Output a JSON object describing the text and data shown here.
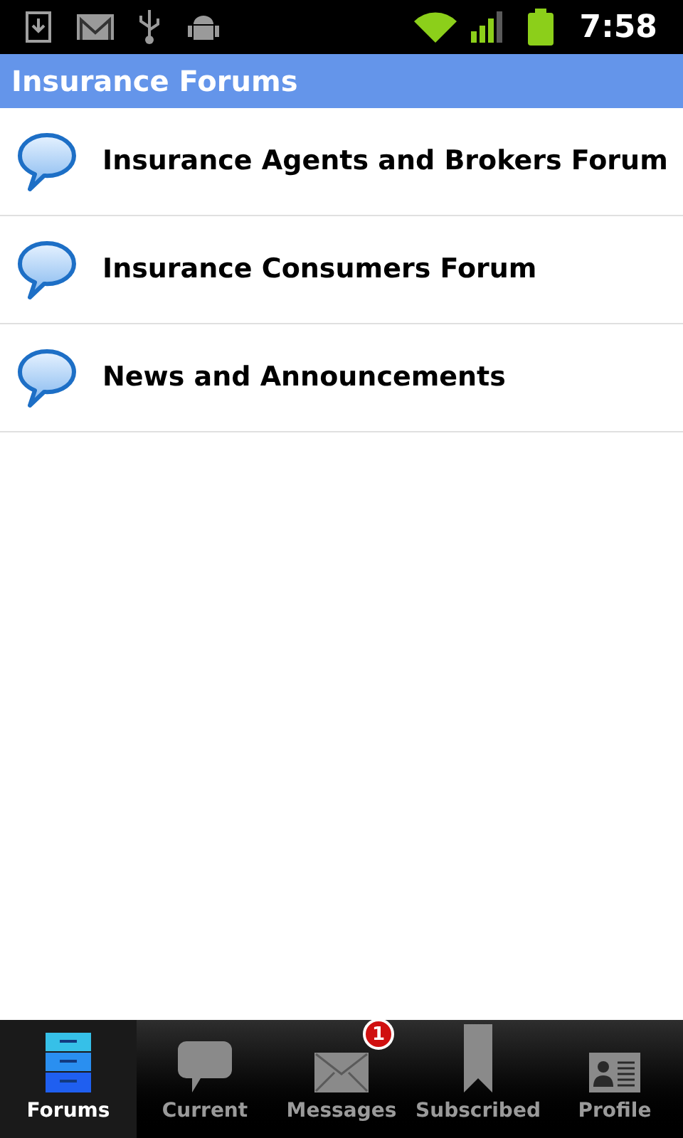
{
  "status_bar": {
    "time": "7:58"
  },
  "header": {
    "title": "Insurance Forums"
  },
  "forums": [
    {
      "title": "Insurance Agents and Brokers Forum"
    },
    {
      "title": "Insurance Consumers Forum"
    },
    {
      "title": "News and Announcements"
    }
  ],
  "tabs": [
    {
      "label": "Forums",
      "kind": "cabinet",
      "selected": true
    },
    {
      "label": "Current",
      "kind": "bubble",
      "selected": false
    },
    {
      "label": "Messages",
      "kind": "envelope",
      "selected": false,
      "badge": "1"
    },
    {
      "label": "Subscribed",
      "kind": "bookmark",
      "selected": false
    },
    {
      "label": "Profile",
      "kind": "card",
      "selected": false
    }
  ]
}
